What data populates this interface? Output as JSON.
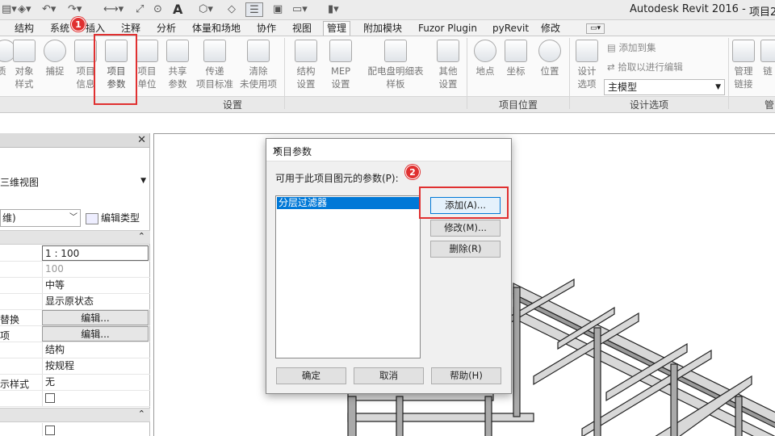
{
  "app": {
    "title": "Autodesk Revit 2016 -",
    "project": "项目2"
  },
  "quick_access": {
    "icons": [
      "folder-icon",
      "save-icon",
      "undo-icon",
      "redo-icon",
      "measure-icon",
      "dimension-icon",
      "tag-icon",
      "text-icon",
      "3d-view-icon",
      "section-icon",
      "thin-lines-icon",
      "close-hidden-icon",
      "switch-windows-icon",
      "settings-icon"
    ]
  },
  "tabs": [
    {
      "label": "结构"
    },
    {
      "label": "系统"
    },
    {
      "label": "插入"
    },
    {
      "label": "注释"
    },
    {
      "label": "分析"
    },
    {
      "label": "体量和场地"
    },
    {
      "label": "协作"
    },
    {
      "label": "视图"
    },
    {
      "label": "管理",
      "active": true
    },
    {
      "label": "附加模块"
    },
    {
      "label": "Fuzor Plugin"
    },
    {
      "label": "pyRevit"
    },
    {
      "label": "修改"
    }
  ],
  "ribbon": {
    "settings_group": {
      "label": "设置",
      "buttons": [
        {
          "line1": "对象",
          "line2": "样式"
        },
        {
          "line1": "捕捉",
          "line2": ""
        },
        {
          "line1": "项目",
          "line2": "信息"
        },
        {
          "line1": "项目",
          "line2": "参数"
        },
        {
          "line1": "项目",
          "line2": "单位"
        },
        {
          "line1": "共享",
          "line2": "参数"
        },
        {
          "line1": "传递",
          "line2": "项目标准"
        },
        {
          "line1": "清除",
          "line2": "未使用项"
        },
        {
          "line1": "结构",
          "line2": "设置"
        },
        {
          "line1": "MEP",
          "line2": "设置"
        },
        {
          "line1": "配电盘明细表",
          "line2": "样板"
        },
        {
          "line1": "其他",
          "line2": "设置"
        }
      ]
    },
    "location_group": {
      "label": "项目位置",
      "buttons": [
        {
          "line1": "地点",
          "line2": ""
        },
        {
          "line1": "坐标",
          "line2": ""
        },
        {
          "line1": "位置",
          "line2": ""
        }
      ]
    },
    "design_options_group": {
      "label": "设计选项",
      "button": {
        "line1": "设计",
        "line2": "选项"
      },
      "add_to_set": "添加到集",
      "pick_to_edit": "拾取以进行编辑",
      "main_model": "主模型"
    },
    "manage_links_group": {
      "button": {
        "line1": "管理",
        "line2": "链接"
      },
      "next_label": "管"
    }
  },
  "callouts": {
    "badge1": "1",
    "badge2": "2"
  },
  "properties": {
    "type_name": "三维视图",
    "filter_value": "维)",
    "edit_type": "编辑类型",
    "rows": [
      {
        "name": "",
        "value": "1 : 100"
      },
      {
        "name": "",
        "value": "100"
      },
      {
        "name": "",
        "value": "中等"
      },
      {
        "name": "",
        "value": "显示原状态"
      },
      {
        "name": "替换",
        "value": "编辑..."
      },
      {
        "name": "项",
        "value": "编辑..."
      },
      {
        "name": "",
        "value": "结构"
      },
      {
        "name": "",
        "value": "按规程"
      },
      {
        "name": "示样式",
        "value": "无"
      }
    ]
  },
  "dialog": {
    "title": "项目参数",
    "label": "可用于此项目图元的参数(P):",
    "list_items": [
      "分层过滤器"
    ],
    "add_button": "添加(A)...",
    "modify_button": "修改(M)...",
    "delete_button": "删除(R)",
    "ok_button": "确定",
    "cancel_button": "取消",
    "help_button": "帮助(H)"
  }
}
